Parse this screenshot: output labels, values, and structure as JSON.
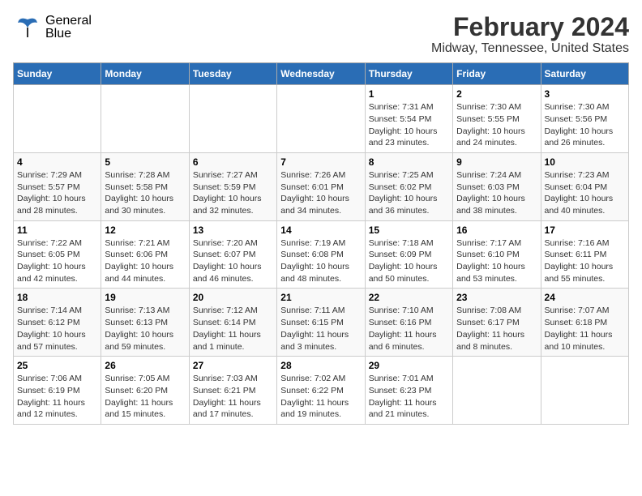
{
  "header": {
    "logo_general": "General",
    "logo_blue": "Blue",
    "title": "February 2024",
    "subtitle": "Midway, Tennessee, United States"
  },
  "days_of_week": [
    "Sunday",
    "Monday",
    "Tuesday",
    "Wednesday",
    "Thursday",
    "Friday",
    "Saturday"
  ],
  "weeks": [
    [
      {
        "day": "",
        "info": ""
      },
      {
        "day": "",
        "info": ""
      },
      {
        "day": "",
        "info": ""
      },
      {
        "day": "",
        "info": ""
      },
      {
        "day": "1",
        "info": "Sunrise: 7:31 AM\nSunset: 5:54 PM\nDaylight: 10 hours and 23 minutes."
      },
      {
        "day": "2",
        "info": "Sunrise: 7:30 AM\nSunset: 5:55 PM\nDaylight: 10 hours and 24 minutes."
      },
      {
        "day": "3",
        "info": "Sunrise: 7:30 AM\nSunset: 5:56 PM\nDaylight: 10 hours and 26 minutes."
      }
    ],
    [
      {
        "day": "4",
        "info": "Sunrise: 7:29 AM\nSunset: 5:57 PM\nDaylight: 10 hours and 28 minutes."
      },
      {
        "day": "5",
        "info": "Sunrise: 7:28 AM\nSunset: 5:58 PM\nDaylight: 10 hours and 30 minutes."
      },
      {
        "day": "6",
        "info": "Sunrise: 7:27 AM\nSunset: 5:59 PM\nDaylight: 10 hours and 32 minutes."
      },
      {
        "day": "7",
        "info": "Sunrise: 7:26 AM\nSunset: 6:01 PM\nDaylight: 10 hours and 34 minutes."
      },
      {
        "day": "8",
        "info": "Sunrise: 7:25 AM\nSunset: 6:02 PM\nDaylight: 10 hours and 36 minutes."
      },
      {
        "day": "9",
        "info": "Sunrise: 7:24 AM\nSunset: 6:03 PM\nDaylight: 10 hours and 38 minutes."
      },
      {
        "day": "10",
        "info": "Sunrise: 7:23 AM\nSunset: 6:04 PM\nDaylight: 10 hours and 40 minutes."
      }
    ],
    [
      {
        "day": "11",
        "info": "Sunrise: 7:22 AM\nSunset: 6:05 PM\nDaylight: 10 hours and 42 minutes."
      },
      {
        "day": "12",
        "info": "Sunrise: 7:21 AM\nSunset: 6:06 PM\nDaylight: 10 hours and 44 minutes."
      },
      {
        "day": "13",
        "info": "Sunrise: 7:20 AM\nSunset: 6:07 PM\nDaylight: 10 hours and 46 minutes."
      },
      {
        "day": "14",
        "info": "Sunrise: 7:19 AM\nSunset: 6:08 PM\nDaylight: 10 hours and 48 minutes."
      },
      {
        "day": "15",
        "info": "Sunrise: 7:18 AM\nSunset: 6:09 PM\nDaylight: 10 hours and 50 minutes."
      },
      {
        "day": "16",
        "info": "Sunrise: 7:17 AM\nSunset: 6:10 PM\nDaylight: 10 hours and 53 minutes."
      },
      {
        "day": "17",
        "info": "Sunrise: 7:16 AM\nSunset: 6:11 PM\nDaylight: 10 hours and 55 minutes."
      }
    ],
    [
      {
        "day": "18",
        "info": "Sunrise: 7:14 AM\nSunset: 6:12 PM\nDaylight: 10 hours and 57 minutes."
      },
      {
        "day": "19",
        "info": "Sunrise: 7:13 AM\nSunset: 6:13 PM\nDaylight: 10 hours and 59 minutes."
      },
      {
        "day": "20",
        "info": "Sunrise: 7:12 AM\nSunset: 6:14 PM\nDaylight: 11 hours and 1 minute."
      },
      {
        "day": "21",
        "info": "Sunrise: 7:11 AM\nSunset: 6:15 PM\nDaylight: 11 hours and 3 minutes."
      },
      {
        "day": "22",
        "info": "Sunrise: 7:10 AM\nSunset: 6:16 PM\nDaylight: 11 hours and 6 minutes."
      },
      {
        "day": "23",
        "info": "Sunrise: 7:08 AM\nSunset: 6:17 PM\nDaylight: 11 hours and 8 minutes."
      },
      {
        "day": "24",
        "info": "Sunrise: 7:07 AM\nSunset: 6:18 PM\nDaylight: 11 hours and 10 minutes."
      }
    ],
    [
      {
        "day": "25",
        "info": "Sunrise: 7:06 AM\nSunset: 6:19 PM\nDaylight: 11 hours and 12 minutes."
      },
      {
        "day": "26",
        "info": "Sunrise: 7:05 AM\nSunset: 6:20 PM\nDaylight: 11 hours and 15 minutes."
      },
      {
        "day": "27",
        "info": "Sunrise: 7:03 AM\nSunset: 6:21 PM\nDaylight: 11 hours and 17 minutes."
      },
      {
        "day": "28",
        "info": "Sunrise: 7:02 AM\nSunset: 6:22 PM\nDaylight: 11 hours and 19 minutes."
      },
      {
        "day": "29",
        "info": "Sunrise: 7:01 AM\nSunset: 6:23 PM\nDaylight: 11 hours and 21 minutes."
      },
      {
        "day": "",
        "info": ""
      },
      {
        "day": "",
        "info": ""
      }
    ]
  ]
}
